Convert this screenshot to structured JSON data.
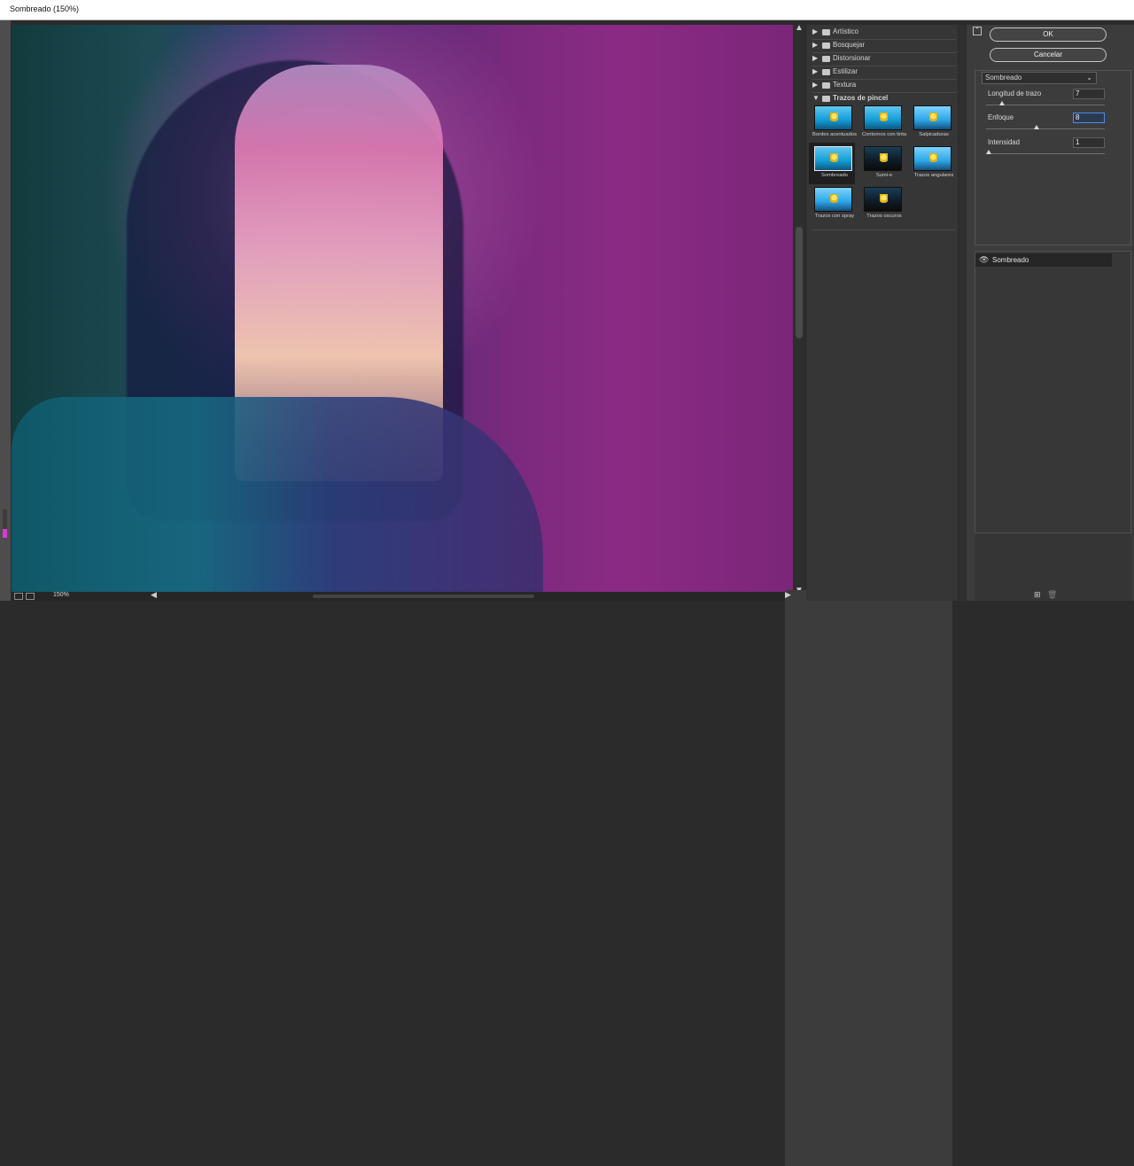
{
  "window": {
    "title": "Sombreado (150%)"
  },
  "preview": {
    "zoom": "150%"
  },
  "gallery": {
    "categories": [
      "Artístico",
      "Bosquejar",
      "Distorsionar",
      "Estilizar",
      "Textura",
      "Trazos de pincel"
    ],
    "open_category": "Trazos de pincel",
    "thumbnails": [
      "Bordes acentuados",
      "Contornos con tinta",
      "Salpicaduras",
      "Sombreado",
      "Sumi-e",
      "Trazos angulares",
      "Trazos con spray",
      "Trazos oscuros"
    ],
    "selected": "Sombreado"
  },
  "controls": {
    "ok": "OK",
    "cancel": "Cancelar",
    "filter_select": "Sombreado",
    "params": [
      {
        "label": "Longitud de trazo",
        "value": "7",
        "position": 0.12
      },
      {
        "label": "Enfoque",
        "value": "8",
        "position": 0.42
      },
      {
        "label": "Intensidad",
        "value": "1",
        "position": 0.0
      }
    ]
  },
  "layers": {
    "items": [
      {
        "name": "Sombreado"
      }
    ]
  }
}
